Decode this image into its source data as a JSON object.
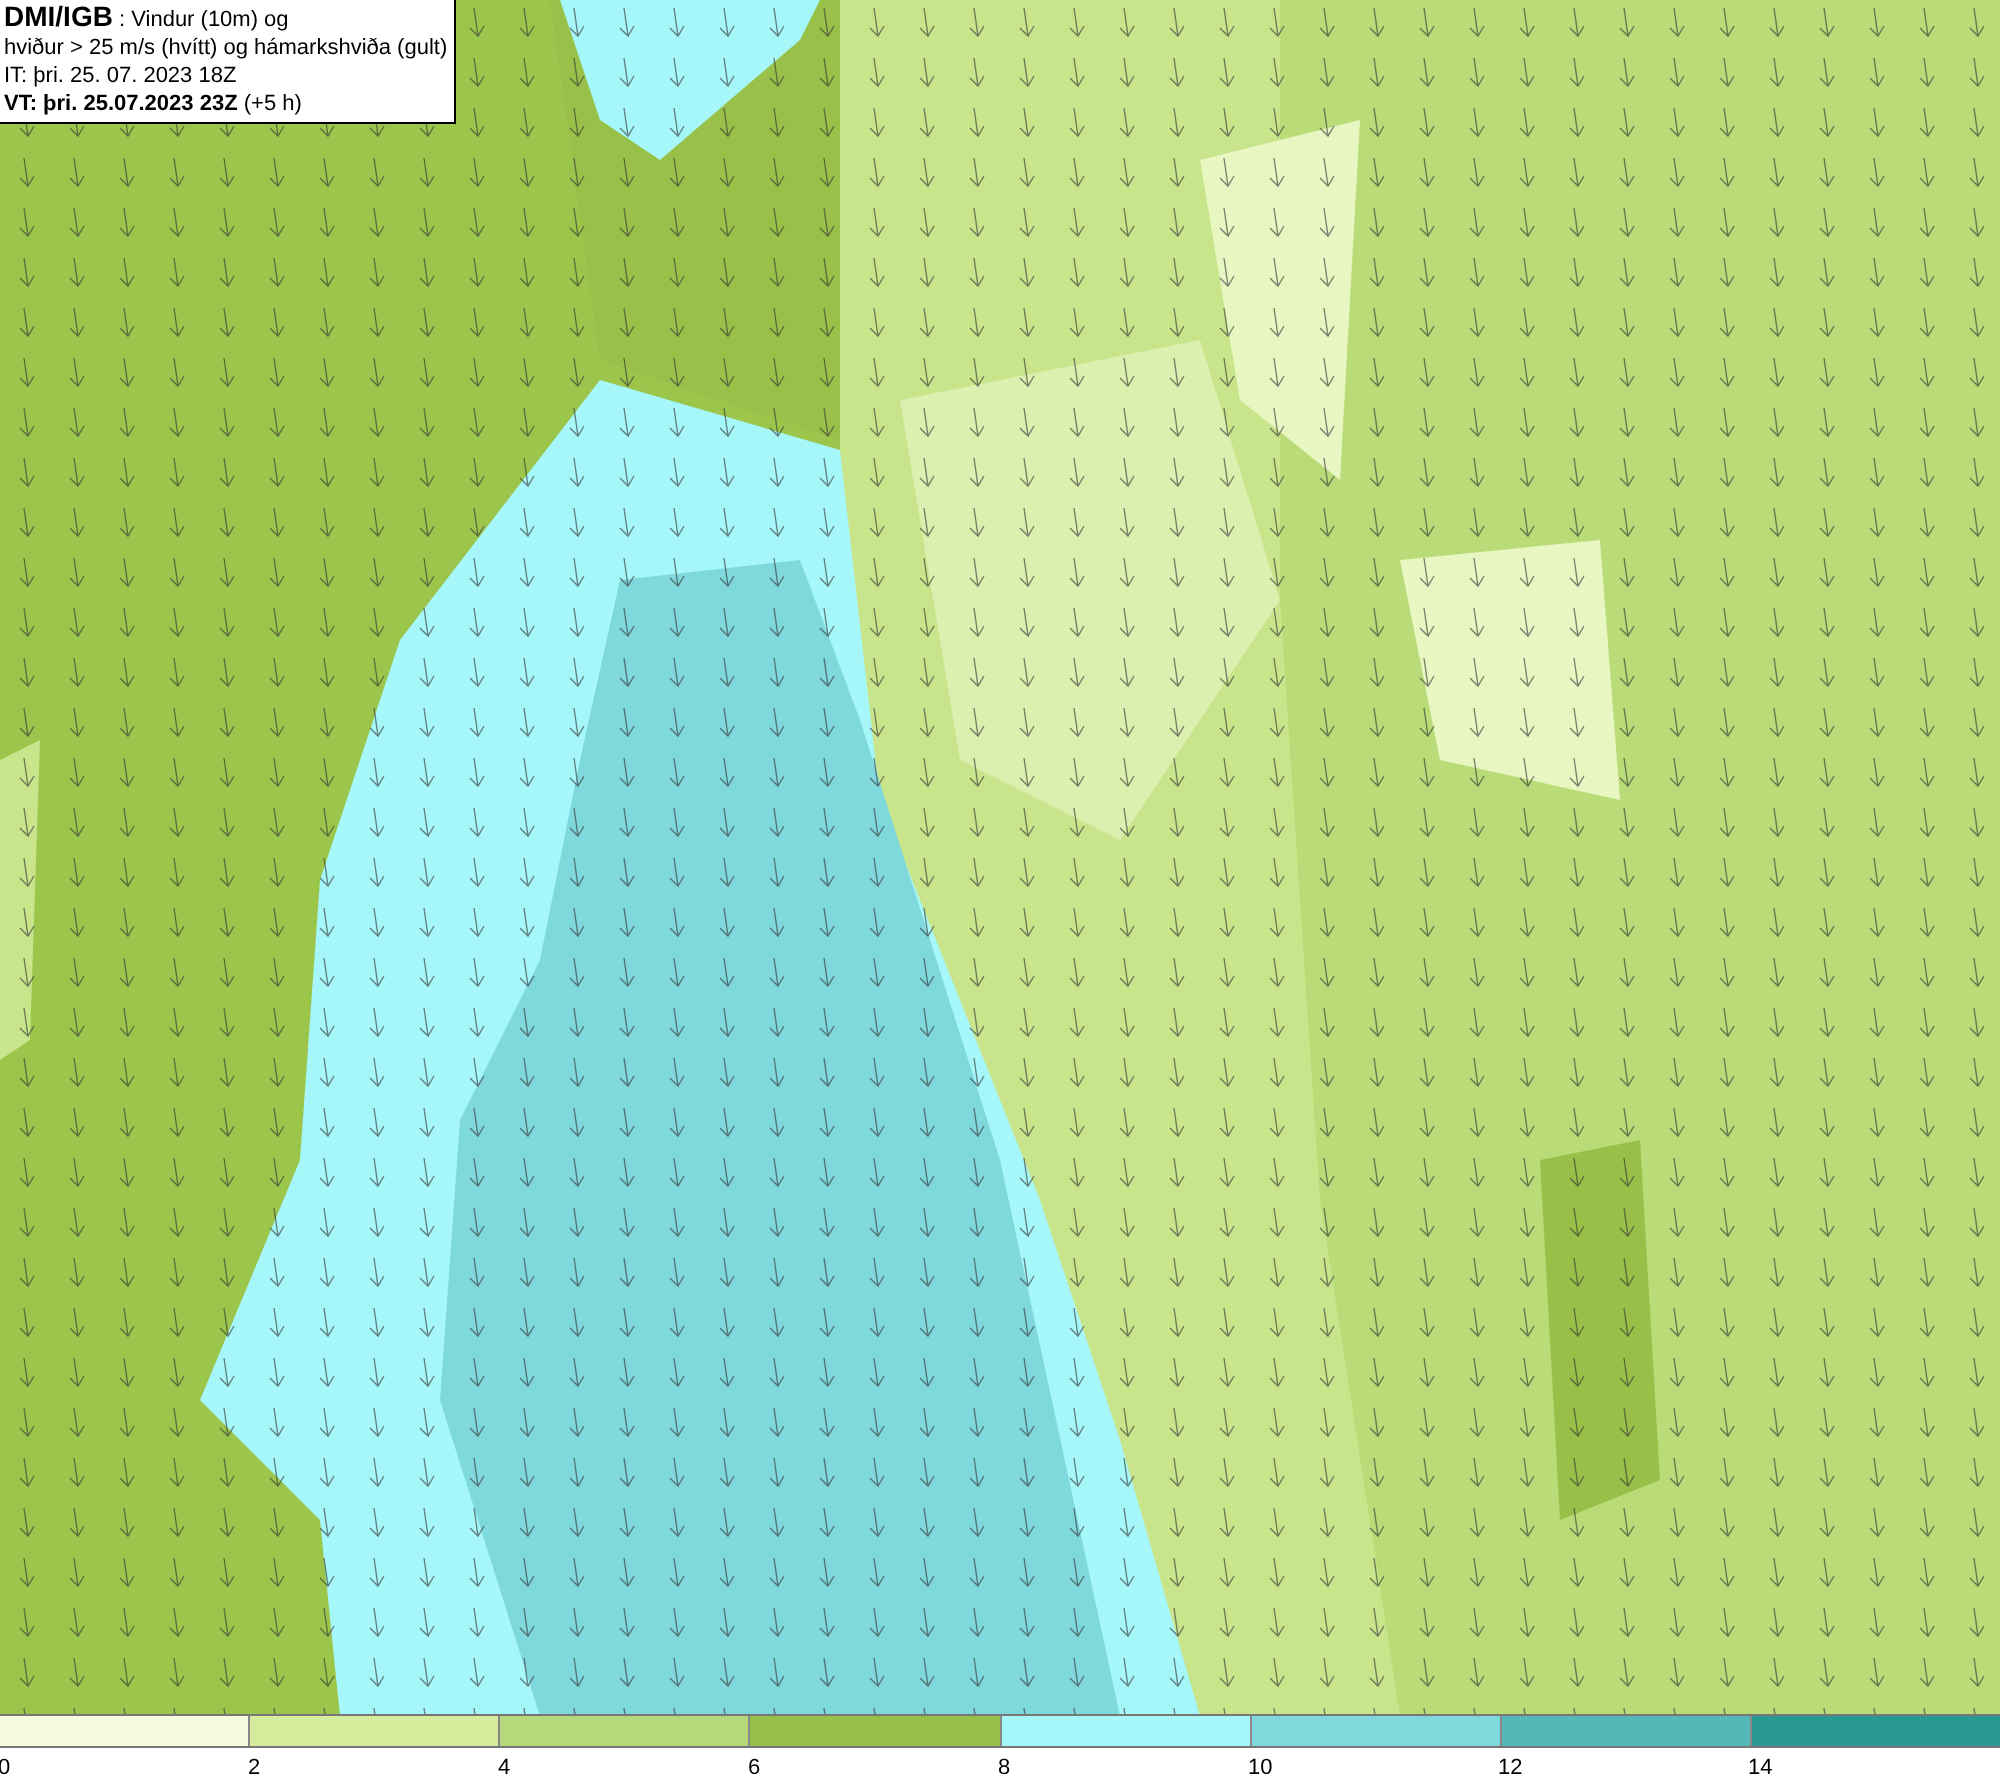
{
  "header": {
    "lines": [
      "**DMI/IGB** : Vindur (10m) og",
      "hviður > 25 m/s (hvítt) og hámarkshviða (gult)",
      "IT: þri. 25. 07. 2023 18Z",
      "**VT: þri. 25.07.2023 23Z** (+5 h)"
    ]
  },
  "legend": {
    "bins": [
      {
        "color": "#f5fbdc",
        "tick": "0"
      },
      {
        "color": "#d4ec9c",
        "tick": "2"
      },
      {
        "color": "#b5d87a",
        "tick": "4"
      },
      {
        "color": "#98bf48",
        "tick": "6"
      },
      {
        "color": "#a6f7f9",
        "tick": "8"
      },
      {
        "color": "#7fd8dc",
        "tick": "10"
      },
      {
        "color": "#55b8b8",
        "tick": "12"
      },
      {
        "color": "#279892",
        "tick": "14"
      }
    ]
  }
}
